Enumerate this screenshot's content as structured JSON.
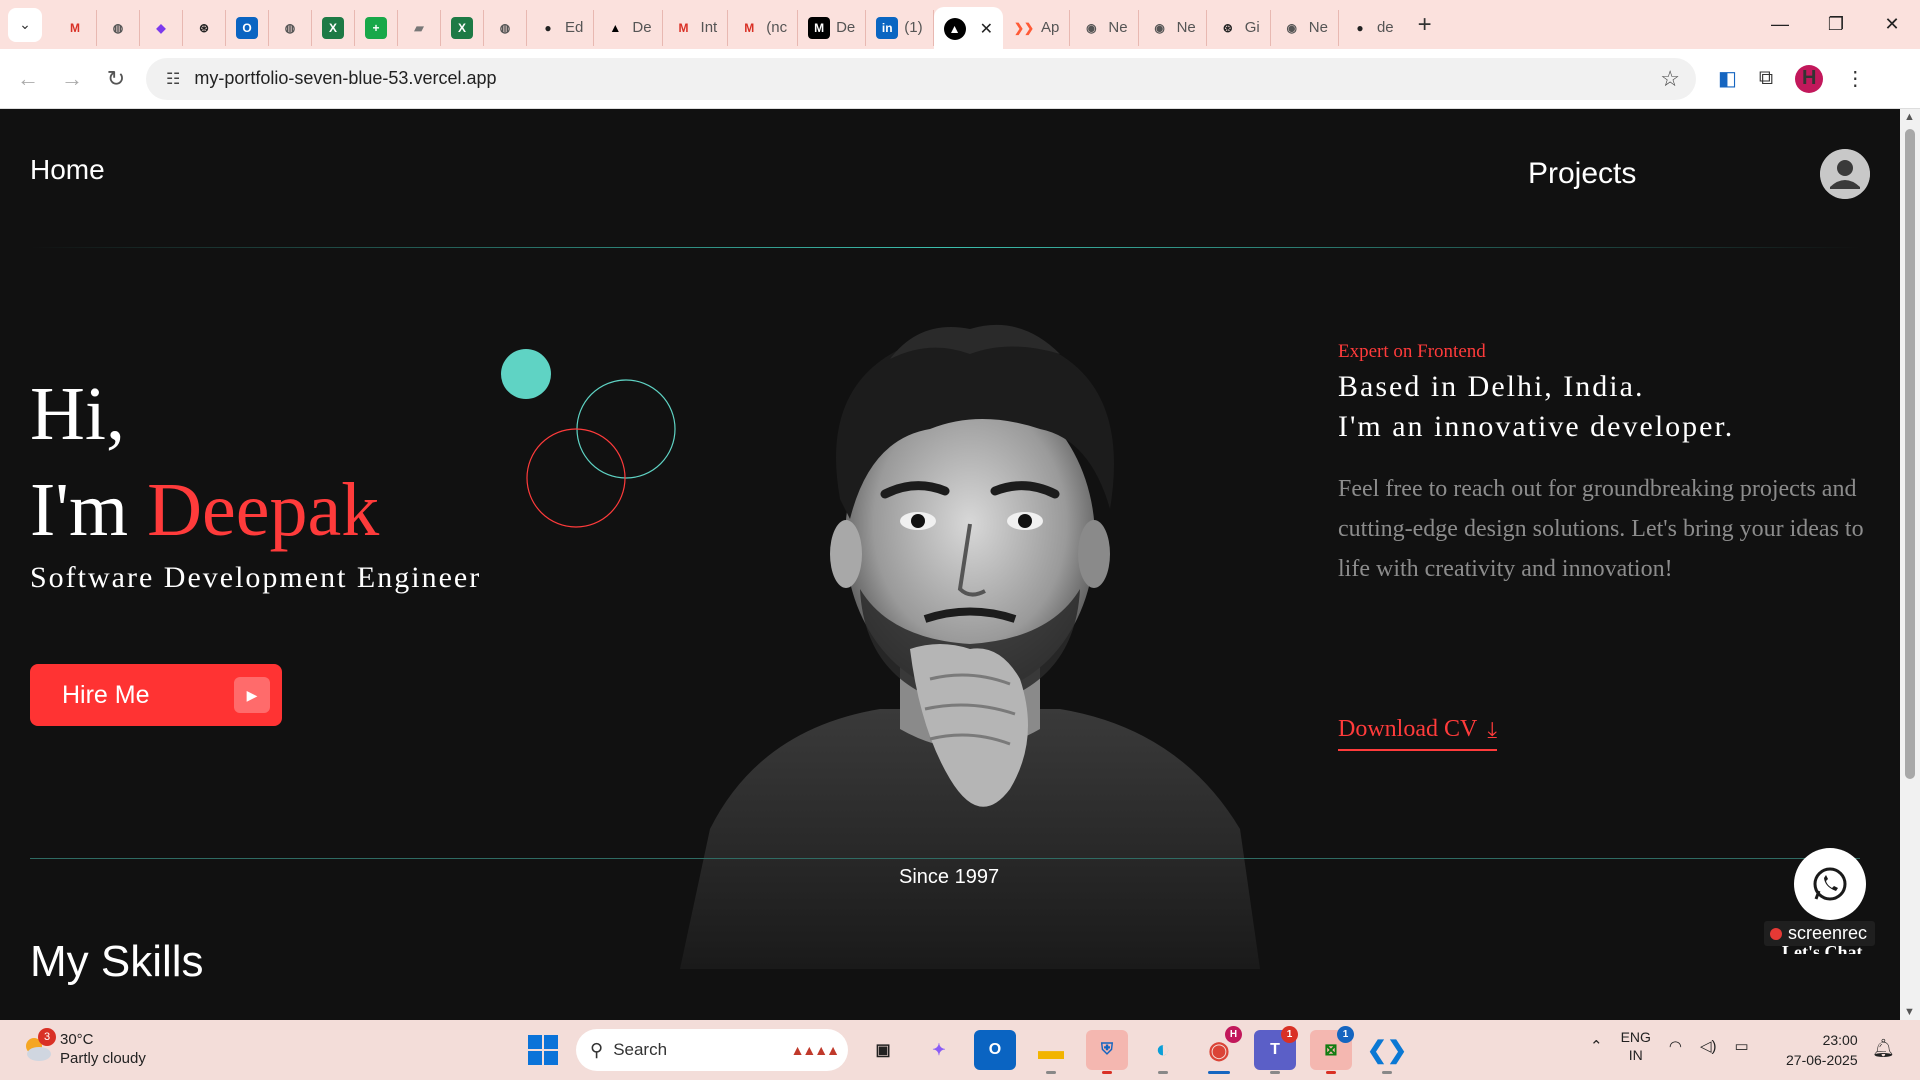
{
  "browser": {
    "tabs": [
      {
        "icon": "chevron-down-icon",
        "title": ""
      },
      {
        "icon": "gmail-icon",
        "title": ""
      },
      {
        "icon": "globe-icon",
        "title": ""
      },
      {
        "icon": "app-icon",
        "title": ""
      },
      {
        "icon": "openai-icon",
        "title": ""
      },
      {
        "icon": "outlook-icon",
        "title": ""
      },
      {
        "icon": "globe-icon",
        "title": ""
      },
      {
        "icon": "excel-icon",
        "title": ""
      },
      {
        "icon": "sheets-icon",
        "title": ""
      },
      {
        "icon": "doc-icon",
        "title": ""
      },
      {
        "icon": "excel-icon",
        "title": ""
      },
      {
        "icon": "globe-icon",
        "title": ""
      },
      {
        "icon": "github-icon",
        "title": "Ed"
      },
      {
        "icon": "vercel-icon",
        "title": "De"
      },
      {
        "icon": "gmail-icon",
        "title": "Int"
      },
      {
        "icon": "gmail-icon",
        "title": "(nc"
      },
      {
        "icon": "medium-icon",
        "title": "De"
      },
      {
        "icon": "linkedin-icon",
        "title": "(1)"
      },
      {
        "icon": "vercel-icon",
        "title": "",
        "active": true
      },
      {
        "icon": "app-icon",
        "title": "Ap"
      },
      {
        "icon": "chrome-icon",
        "title": "Ne"
      },
      {
        "icon": "chrome-icon",
        "title": "Ne"
      },
      {
        "icon": "openai-icon",
        "title": "Gi"
      },
      {
        "icon": "chrome-icon",
        "title": "Ne"
      },
      {
        "icon": "github-icon",
        "title": "de"
      }
    ],
    "url": "my-portfolio-seven-blue-53.vercel.app",
    "profile_initial": "H"
  },
  "page": {
    "nav": {
      "home": "Home",
      "projects": "Projects"
    },
    "hero": {
      "greeting": "Hi,",
      "im": "I'm",
      "name": "Deepak",
      "role": "Software Development Engineer",
      "hire_button": "Hire Me",
      "tagline": "Expert on Frontend",
      "based_line1": "Based in Delhi, India.",
      "based_line2": "I'm an innovative developer.",
      "description": "Feel free to reach out for groundbreaking projects and cutting-edge design solutions. Let's bring your ideas to life with creativity and innovation!",
      "download_cv": "Download CV",
      "since": "Since 1997"
    },
    "skills_heading": "My Skills",
    "chat_label": "Let's Chat",
    "screenrec_label": "screenrec"
  },
  "taskbar": {
    "weather": {
      "temp": "30°C",
      "condition": "Partly cloudy",
      "badge": "3"
    },
    "search_placeholder": "Search",
    "lang": {
      "line1": "ENG",
      "line2": "IN"
    },
    "time": "23:00",
    "date": "27-06-2025",
    "badges": {
      "chrome": "H",
      "teams": "1",
      "xbox": "1"
    }
  },
  "colors": {
    "accent_red": "#ff3b3b",
    "teal": "#5fd3c4",
    "background": "#111111"
  }
}
